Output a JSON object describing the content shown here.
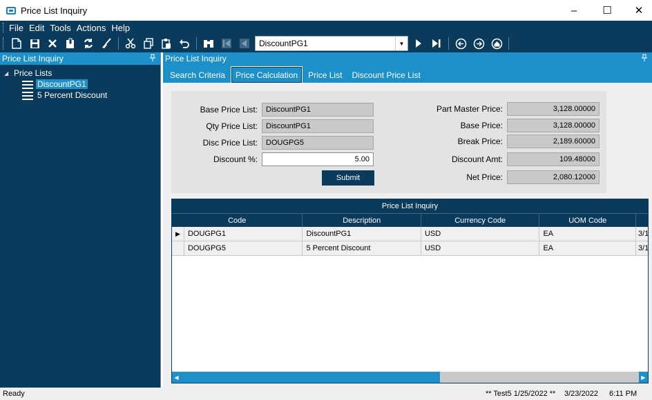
{
  "window": {
    "title": "Price List Inquiry",
    "minimize": "–",
    "maximize": "☐",
    "close": "✕"
  },
  "menu": [
    "File",
    "Edit",
    "Tools",
    "Actions",
    "Help"
  ],
  "toolbar": {
    "record_value": "DiscountPG1"
  },
  "left_panel": {
    "title": "Price List Inquiry",
    "pin": "📌",
    "tree": {
      "root": "Price Lists",
      "children": [
        "DiscountPG1",
        "5 Percent Discount"
      ]
    }
  },
  "right_panel": {
    "title": "Price List Inquiry",
    "tabs": [
      "Search Criteria",
      "Price Calculation",
      "Price List",
      "Discount Price List"
    ],
    "active_tab": "Price Calculation"
  },
  "form": {
    "base_price_list_label": "Base Price List:",
    "base_price_list": "DiscountPG1",
    "qty_price_list_label": "Qty Price List:",
    "qty_price_list": "DiscountPG1",
    "disc_price_list_label": "Disc Price List:",
    "disc_price_list": "DOUGPG5",
    "discount_pct_label": "Discount %:",
    "discount_pct": "5.00",
    "submit_label": "Submit",
    "part_master_price_label": "Part Master Price:",
    "part_master_price": "3,128.00000",
    "base_price_label": "Base Price:",
    "base_price": "3,128.00000",
    "break_price_label": "Break Price:",
    "break_price": "2,189.60000",
    "discount_amt_label": "Discount Amt:",
    "discount_amt": "109.48000",
    "net_price_label": "Net Price:",
    "net_price": "2,080.12000"
  },
  "grid": {
    "title": "Price List Inquiry",
    "columns": [
      "Code",
      "Description",
      "Currency Code",
      "UOM Code"
    ],
    "rows": [
      [
        "DOUGPG1",
        "DiscountPG1",
        "USD",
        "EA",
        "3/1"
      ],
      [
        "DOUGPG5",
        "5 Percent Discount",
        "USD",
        "EA",
        "3/1"
      ]
    ]
  },
  "status": {
    "left": "Ready",
    "env": "** Test5 1/25/2022 **",
    "date": "3/23/2022",
    "time": "6:11 PM"
  }
}
